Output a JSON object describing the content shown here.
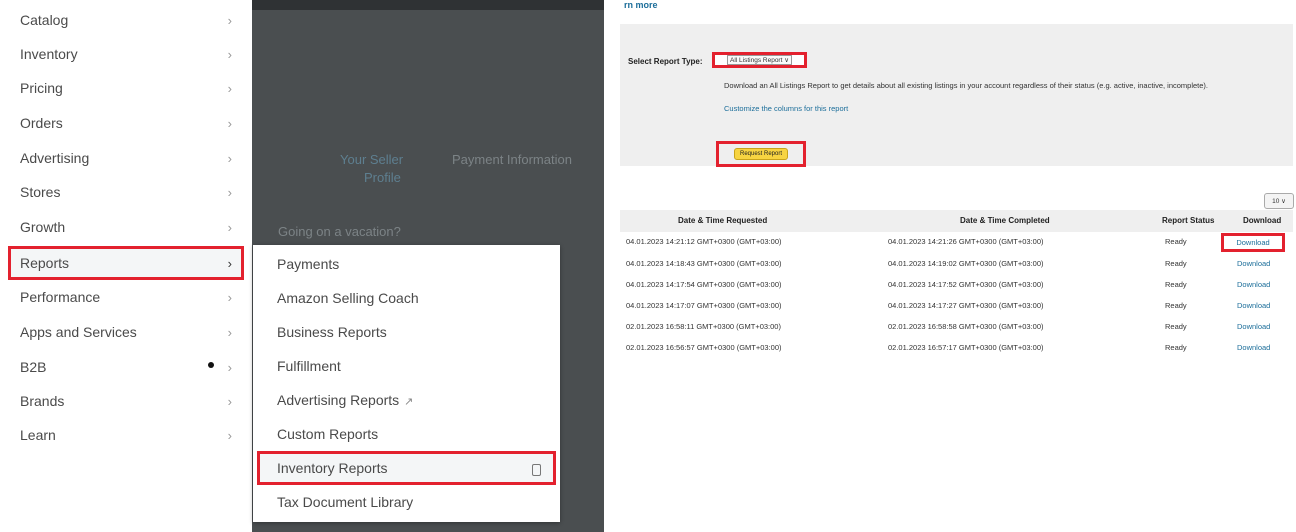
{
  "menu": {
    "items": [
      {
        "label": "Catalog"
      },
      {
        "label": "Inventory"
      },
      {
        "label": "Pricing"
      },
      {
        "label": "Orders"
      },
      {
        "label": "Advertising"
      },
      {
        "label": "Stores"
      },
      {
        "label": "Growth"
      },
      {
        "label": "Reports",
        "active": true
      },
      {
        "label": "Performance"
      },
      {
        "label": "Apps and Services"
      },
      {
        "label": "B2B",
        "dot": true
      },
      {
        "label": "Brands"
      },
      {
        "label": "Learn"
      }
    ],
    "chevron": "›"
  },
  "backdrop": {
    "your_seller_profile_1": "Your Seller",
    "your_seller_profile_2": "Profile",
    "payment_information": "Payment Information",
    "going_on_vacation": "Going on a vacation?"
  },
  "submenu": {
    "items": [
      {
        "label": "Payments"
      },
      {
        "label": "Amazon Selling Coach"
      },
      {
        "label": "Business Reports"
      },
      {
        "label": "Fulfillment"
      },
      {
        "label": "Advertising Reports",
        "external": true
      },
      {
        "label": "Custom Reports"
      },
      {
        "label": "Inventory Reports",
        "active": true,
        "pinned": true
      },
      {
        "label": "Tax Document Library"
      }
    ],
    "external_icon": "external-link-icon",
    "pin_icon": "pin-icon"
  },
  "report": {
    "learn_more": "rn more",
    "select_label": "Select Report Type:",
    "selected_type": "All Listings Report",
    "description": "Download an All Listings Report to get details about all existing listings in your account regardless of their status (e.g. active, inactive, incomplete).",
    "customize_link": "Customize the columns for this report",
    "request_button": "Request Report",
    "page_size": "10"
  },
  "table": {
    "headers": [
      "Date & Time Requested",
      "Date & Time Completed",
      "Report Status",
      "Download"
    ],
    "rows": [
      {
        "requested": "04.01.2023 14:21:12 GMT+0300 (GMT+03:00)",
        "completed": "04.01.2023 14:21:26 GMT+0300 (GMT+03:00)",
        "status": "Ready",
        "download": "Download",
        "highlight": true
      },
      {
        "requested": "04.01.2023 14:18:43 GMT+0300 (GMT+03:00)",
        "completed": "04.01.2023 14:19:02 GMT+0300 (GMT+03:00)",
        "status": "Ready",
        "download": "Download"
      },
      {
        "requested": "04.01.2023 14:17:54 GMT+0300 (GMT+03:00)",
        "completed": "04.01.2023 14:17:52 GMT+0300 (GMT+03:00)",
        "status": "Ready",
        "download": "Download"
      },
      {
        "requested": "04.01.2023 14:17:07 GMT+0300 (GMT+03:00)",
        "completed": "04.01.2023 14:17:27 GMT+0300 (GMT+03:00)",
        "status": "Ready",
        "download": "Download"
      },
      {
        "requested": "02.01.2023 16:58:11 GMT+0300 (GMT+03:00)",
        "completed": "02.01.2023 16:58:58 GMT+0300 (GMT+03:00)",
        "status": "Ready",
        "download": "Download"
      },
      {
        "requested": "02.01.2023 16:56:57 GMT+0300 (GMT+03:00)",
        "completed": "02.01.2023 16:57:17 GMT+0300 (GMT+03:00)",
        "status": "Ready",
        "download": "Download"
      }
    ]
  },
  "colors": {
    "highlight": "#e3212e",
    "link": "#1c6e9a",
    "button": "#f7d441"
  }
}
